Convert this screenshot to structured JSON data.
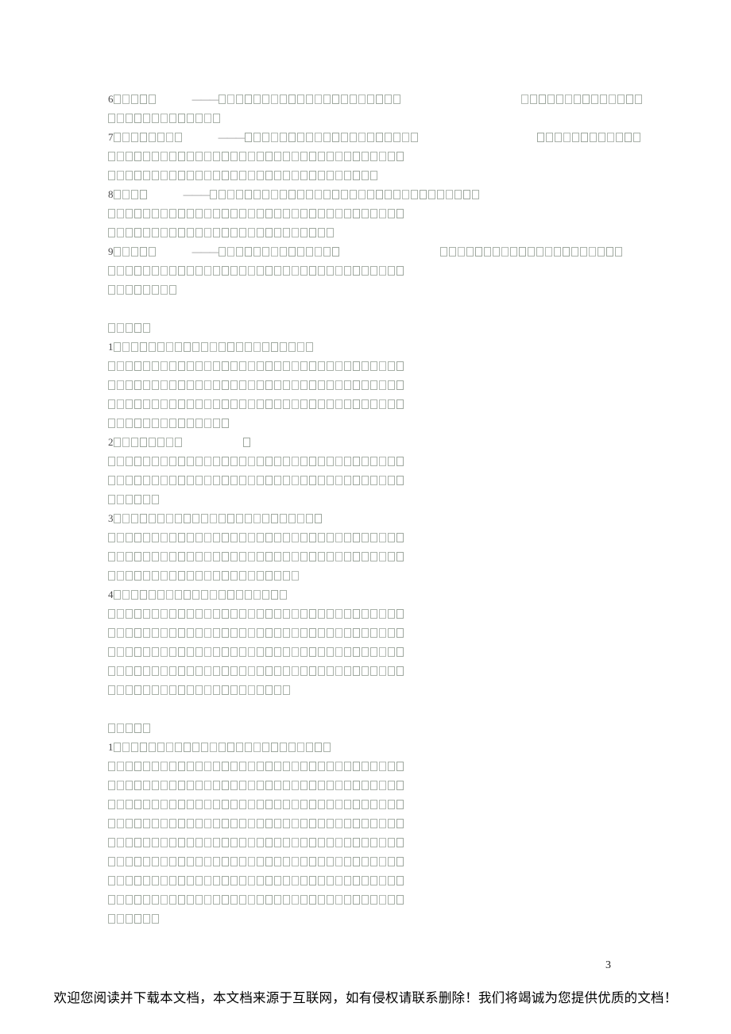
{
  "document": {
    "page_number": "3",
    "footer_text": "欢迎您阅读并下载本文档，本文档来源于互联网，如有侵权请联系删除！我们将竭诚为您提供优质的文档！",
    "note": "CJK body glyphs are unrenderable in the source image and display as hollow replacement boxes (tofu).",
    "separator_dash": "———",
    "text_color": "#6f6f6f",
    "box_color": "#a9b1a9",
    "footer_color": "#000000"
  },
  "body": {
    "blocks": [
      {
        "id": "item-6",
        "lines": [
          {
            "number": "6",
            "boxes_before_dash": 5,
            "dash": true,
            "boxes_after_dash": 21,
            "gap": 150,
            "boxes_tail": 14
          },
          {
            "boxes": 13
          }
        ]
      },
      {
        "id": "item-7",
        "lines": [
          {
            "number": "7",
            "boxes_before_dash": 8,
            "dash": true,
            "boxes_after_dash": 20,
            "gap": 148,
            "boxes_tail": 12
          },
          {
            "boxes": 34
          },
          {
            "boxes": 31
          }
        ]
      },
      {
        "id": "item-8",
        "lines": [
          {
            "number": "8",
            "boxes_before_dash": 4,
            "dash": true,
            "boxes_after_dash": 31
          },
          {
            "boxes": 34
          },
          {
            "boxes": 26
          }
        ]
      },
      {
        "id": "item-9",
        "lines": [
          {
            "number": "9",
            "boxes_before_dash": 5,
            "dash": true,
            "boxes_after_dash": 14,
            "gap": 125,
            "boxes_tail": 21
          },
          {
            "boxes": 34
          },
          {
            "boxes": 8
          }
        ]
      },
      {
        "id": "spacer-1",
        "lines": [
          {
            "blank": true
          }
        ]
      },
      {
        "id": "section-heading-a",
        "lines": [
          {
            "boxes": 5
          }
        ]
      },
      {
        "id": "section-a-item-1",
        "lines": [
          {
            "number": "1",
            "boxes": 23
          },
          {
            "boxes": 34
          },
          {
            "boxes": 34
          },
          {
            "boxes": 34
          },
          {
            "boxes": 14
          }
        ]
      },
      {
        "id": "section-a-item-2",
        "lines": [
          {
            "number": "2",
            "boxes": 8,
            "gap": 75,
            "boxes_tail": 1
          },
          {
            "boxes": 34
          },
          {
            "boxes": 34
          },
          {
            "boxes": 6
          }
        ]
      },
      {
        "id": "section-a-item-3",
        "lines": [
          {
            "number": "3",
            "boxes": 24
          },
          {
            "boxes": 34
          },
          {
            "boxes": 34
          },
          {
            "boxes": 22
          }
        ]
      },
      {
        "id": "section-a-item-4",
        "lines": [
          {
            "number": "4",
            "boxes": 20
          },
          {
            "boxes": 34
          },
          {
            "boxes": 34
          },
          {
            "boxes": 34
          },
          {
            "boxes": 34
          },
          {
            "boxes": 21
          }
        ]
      },
      {
        "id": "spacer-2",
        "lines": [
          {
            "blank": true
          }
        ]
      },
      {
        "id": "section-heading-b",
        "lines": [
          {
            "boxes": 5
          }
        ]
      },
      {
        "id": "section-b-item-1",
        "lines": [
          {
            "number": "1",
            "boxes": 25
          },
          {
            "boxes": 34
          },
          {
            "boxes": 34
          },
          {
            "boxes": 34
          },
          {
            "boxes": 34
          },
          {
            "boxes": 34
          },
          {
            "boxes": 34
          },
          {
            "boxes": 34
          },
          {
            "boxes": 34
          },
          {
            "boxes": 6
          }
        ]
      }
    ]
  }
}
